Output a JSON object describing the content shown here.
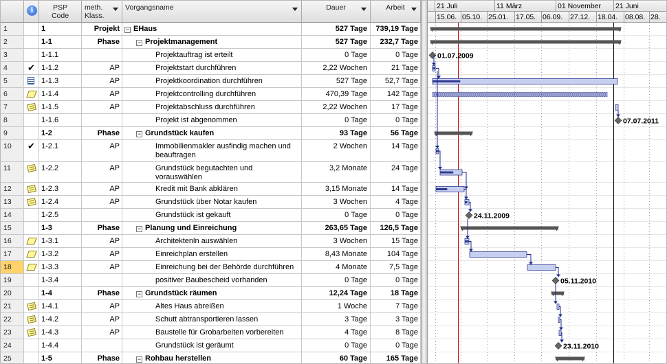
{
  "columns": {
    "info": "i",
    "psp": "PSP\nCode",
    "klass": "meth.\nKlass.",
    "name": "Vorgangsname",
    "dauer": "Dauer",
    "arbeit": "Arbeit"
  },
  "timescale": {
    "top": [
      "21 Juli",
      "11 März",
      "01 November",
      "21 Juni"
    ],
    "bottom": [
      "15.06.",
      "05.10.",
      "25.01.",
      "17.05.",
      "06.09.",
      "27.12.",
      "18.04.",
      "08.08.",
      "28."
    ]
  },
  "rows": [
    {
      "num": "1",
      "psp": "1",
      "klass": "Projekt",
      "name": "EHaus",
      "dauer": "527 Tage",
      "arbeit": "739,19 Tage",
      "summary": true,
      "level": 0,
      "ind": ""
    },
    {
      "num": "2",
      "psp": "1-1",
      "klass": "Phase",
      "name": "Projektmanagement",
      "dauer": "527 Tage",
      "arbeit": "232,7 Tage",
      "summary": true,
      "level": 1,
      "ind": ""
    },
    {
      "num": "3",
      "psp": "1-1.1",
      "klass": "",
      "name": "Projektauftrag ist erteilt",
      "dauer": "0 Tage",
      "arbeit": "0 Tage",
      "summary": false,
      "level": 2,
      "ind": ""
    },
    {
      "num": "4",
      "psp": "1-1.2",
      "klass": "AP",
      "name": "Projektstart durchführen",
      "dauer": "2,22 Wochen",
      "arbeit": "21 Tage",
      "summary": false,
      "level": 2,
      "ind": "check"
    },
    {
      "num": "5",
      "psp": "1-1.3",
      "klass": "AP",
      "name": "Projektkoordination durchführen",
      "dauer": "527 Tage",
      "arbeit": "52,7 Tage",
      "summary": false,
      "level": 2,
      "ind": "cal"
    },
    {
      "num": "6",
      "psp": "1-1.4",
      "klass": "AP",
      "name": "Projektcontrolling durchführen",
      "dauer": "470,39 Tage",
      "arbeit": "142 Tage",
      "summary": false,
      "level": 2,
      "ind": "pencil"
    },
    {
      "num": "7",
      "psp": "1-1.5",
      "klass": "AP",
      "name": "Projektabschluss durchführen",
      "dauer": "2,22 Wochen",
      "arbeit": "17 Tage",
      "summary": false,
      "level": 2,
      "ind": "note"
    },
    {
      "num": "8",
      "psp": "1-1.6",
      "klass": "",
      "name": "Projekt ist abgenommen",
      "dauer": "0 Tage",
      "arbeit": "0 Tage",
      "summary": false,
      "level": 2,
      "ind": ""
    },
    {
      "num": "9",
      "psp": "1-2",
      "klass": "Phase",
      "name": "Grundstück kaufen",
      "dauer": "93 Tage",
      "arbeit": "56 Tage",
      "summary": true,
      "level": 1,
      "ind": ""
    },
    {
      "num": "10",
      "psp": "1-2.1",
      "klass": "AP",
      "name": "Immobilienmakler ausfindig machen und beauftragen",
      "dauer": "2 Wochen",
      "arbeit": "14 Tage",
      "summary": false,
      "level": 2,
      "ind": "check",
      "tall": true
    },
    {
      "num": "11",
      "psp": "1-2.2",
      "klass": "AP",
      "name": "Grundstück begutachten und vorauswählen",
      "dauer": "3,2 Monate",
      "arbeit": "24 Tage",
      "summary": false,
      "level": 2,
      "ind": "note",
      "tall": true
    },
    {
      "num": "12",
      "psp": "1-2.3",
      "klass": "AP",
      "name": "Kredit mit Bank abklären",
      "dauer": "3,15 Monate",
      "arbeit": "14 Tage",
      "summary": false,
      "level": 2,
      "ind": "note"
    },
    {
      "num": "13",
      "psp": "1-2.4",
      "klass": "AP",
      "name": "Grundstück über Notar kaufen",
      "dauer": "3 Wochen",
      "arbeit": "4 Tage",
      "summary": false,
      "level": 2,
      "ind": "note"
    },
    {
      "num": "14",
      "psp": "1-2.5",
      "klass": "",
      "name": "Grundstück ist gekauft",
      "dauer": "0 Tage",
      "arbeit": "0 Tage",
      "summary": false,
      "level": 2,
      "ind": ""
    },
    {
      "num": "15",
      "psp": "1-3",
      "klass": "Phase",
      "name": "Planung und Einreichung",
      "dauer": "263,65 Tage",
      "arbeit": "126,5 Tage",
      "summary": true,
      "level": 1,
      "ind": ""
    },
    {
      "num": "16",
      "psp": "1-3.1",
      "klass": "AP",
      "name": "Architektenln auswählen",
      "dauer": "3 Wochen",
      "arbeit": "15 Tage",
      "summary": false,
      "level": 2,
      "ind": "pencil"
    },
    {
      "num": "17",
      "psp": "1-3.2",
      "klass": "AP",
      "name": "Einreichplan erstellen",
      "dauer": "8,43 Monate",
      "arbeit": "104 Tage",
      "summary": false,
      "level": 2,
      "ind": "pencil"
    },
    {
      "num": "18",
      "psp": "1-3.3",
      "klass": "AP",
      "name": "Einreichung bei der Behörde durchführen",
      "dauer": "4 Monate",
      "arbeit": "7,5 Tage",
      "summary": false,
      "level": 2,
      "ind": "pencil",
      "selected": true
    },
    {
      "num": "19",
      "psp": "1-3.4",
      "klass": "",
      "name": "positiver Baubescheid vorhanden",
      "dauer": "0 Tage",
      "arbeit": "0 Tage",
      "summary": false,
      "level": 2,
      "ind": ""
    },
    {
      "num": "20",
      "psp": "1-4",
      "klass": "Phase",
      "name": "Grundstück räumen",
      "dauer": "12,24 Tage",
      "arbeit": "18 Tage",
      "summary": true,
      "level": 1,
      "ind": ""
    },
    {
      "num": "21",
      "psp": "1-4.1",
      "klass": "AP",
      "name": "Altes Haus abreißen",
      "dauer": "1 Woche",
      "arbeit": "7 Tage",
      "summary": false,
      "level": 2,
      "ind": "note"
    },
    {
      "num": "22",
      "psp": "1-4.2",
      "klass": "AP",
      "name": "Schutt abtransportieren lassen",
      "dauer": "3 Tage",
      "arbeit": "3 Tage",
      "summary": false,
      "level": 2,
      "ind": "note"
    },
    {
      "num": "23",
      "psp": "1-4.3",
      "klass": "AP",
      "name": "Baustelle für Grobarbeiten vorbereiten",
      "dauer": "4 Tage",
      "arbeit": "8 Tage",
      "summary": false,
      "level": 2,
      "ind": "note"
    },
    {
      "num": "24",
      "psp": "1-4.4",
      "klass": "",
      "name": "Grundstück ist geräumt",
      "dauer": "0 Tage",
      "arbeit": "0 Tage",
      "summary": false,
      "level": 2,
      "ind": ""
    },
    {
      "num": "25",
      "psp": "1-5",
      "klass": "Phase",
      "name": "Rohbau herstellen",
      "dauer": "60 Tage",
      "arbeit": "165 Tage",
      "summary": true,
      "level": 1,
      "ind": ""
    }
  ],
  "gantt": {
    "milestones": [
      {
        "row": 3,
        "label": "01.07.2009"
      },
      {
        "row": 8,
        "label": "07.07.2011"
      },
      {
        "row": 14,
        "label": "24.11.2009"
      },
      {
        "row": 19,
        "label": "05.11.2010"
      },
      {
        "row": 24,
        "label": "23.11.2010"
      }
    ]
  },
  "colors": {
    "bar_fill": "#c7cff0",
    "bar_border": "#2f3a8f",
    "summary": "#555555",
    "link": "#1b2a8c",
    "status_line": "#c00000",
    "selected_row": "#ffd26a"
  }
}
